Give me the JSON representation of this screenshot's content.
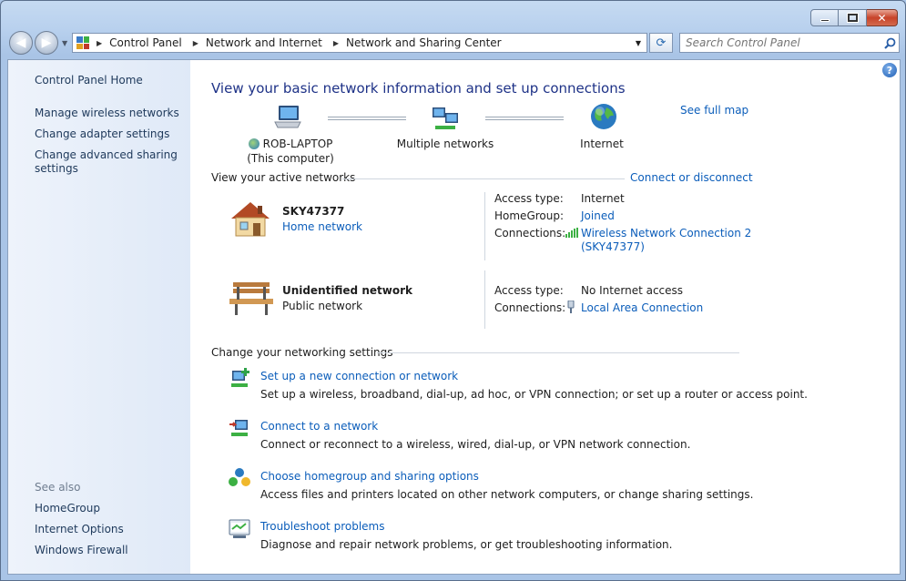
{
  "window": {
    "close_glyph": "✕"
  },
  "nav": {
    "back_glyph": "◀",
    "forward_glyph": "▶",
    "breadcrumbs": [
      "Control Panel",
      "Network and Internet",
      "Network and Sharing Center"
    ],
    "search_placeholder": "Search Control Panel",
    "refresh_glyph": "⟳"
  },
  "sidebar": {
    "home": "Control Panel Home",
    "items": [
      "Manage wireless networks",
      "Change adapter settings",
      "Change advanced sharing",
      "settings"
    ],
    "see_also_label": "See also",
    "see_also": [
      "HomeGroup",
      "Internet Options",
      "Windows Firewall"
    ]
  },
  "main": {
    "help_glyph": "?",
    "title": "View your basic network information and set up connections",
    "see_full_map": "See full map",
    "map": {
      "computer_name": "ROB-LAPTOP",
      "computer_sub": "(This computer)",
      "middle": "Multiple networks",
      "internet": "Internet"
    },
    "active_networks_label": "View your active networks",
    "connect_or_disconnect": "Connect or disconnect",
    "networks": [
      {
        "name": "SKY47377",
        "type": "Home network",
        "access_type_label": "Access type:",
        "access_type": "Internet",
        "homegroup_label": "HomeGroup:",
        "homegroup": "Joined",
        "connections_label": "Connections:",
        "connection_line1": "Wireless Network Connection 2",
        "connection_line2": "(SKY47377)"
      },
      {
        "name": "Unidentified network",
        "type": "Public network",
        "access_type_label": "Access type:",
        "access_type": "No Internet access",
        "connections_label": "Connections:",
        "connection_line1": "Local Area Connection"
      }
    ],
    "change_settings_label": "Change your networking settings",
    "tasks": [
      {
        "title": "Set up a new connection or network",
        "desc": "Set up a wireless, broadband, dial-up, ad hoc, or VPN connection; or set up a router or access point."
      },
      {
        "title": "Connect to a network",
        "desc": "Connect or reconnect to a wireless, wired, dial-up, or VPN network connection."
      },
      {
        "title": "Choose homegroup and sharing options",
        "desc": "Access files and printers located on other network computers, or change sharing settings."
      },
      {
        "title": "Troubleshoot problems",
        "desc": "Diagnose and repair network problems, or get troubleshooting information."
      }
    ]
  },
  "colors": {
    "link": "#0b5dba",
    "title": "#1e3287",
    "sidebar_link": "#1e395b"
  }
}
